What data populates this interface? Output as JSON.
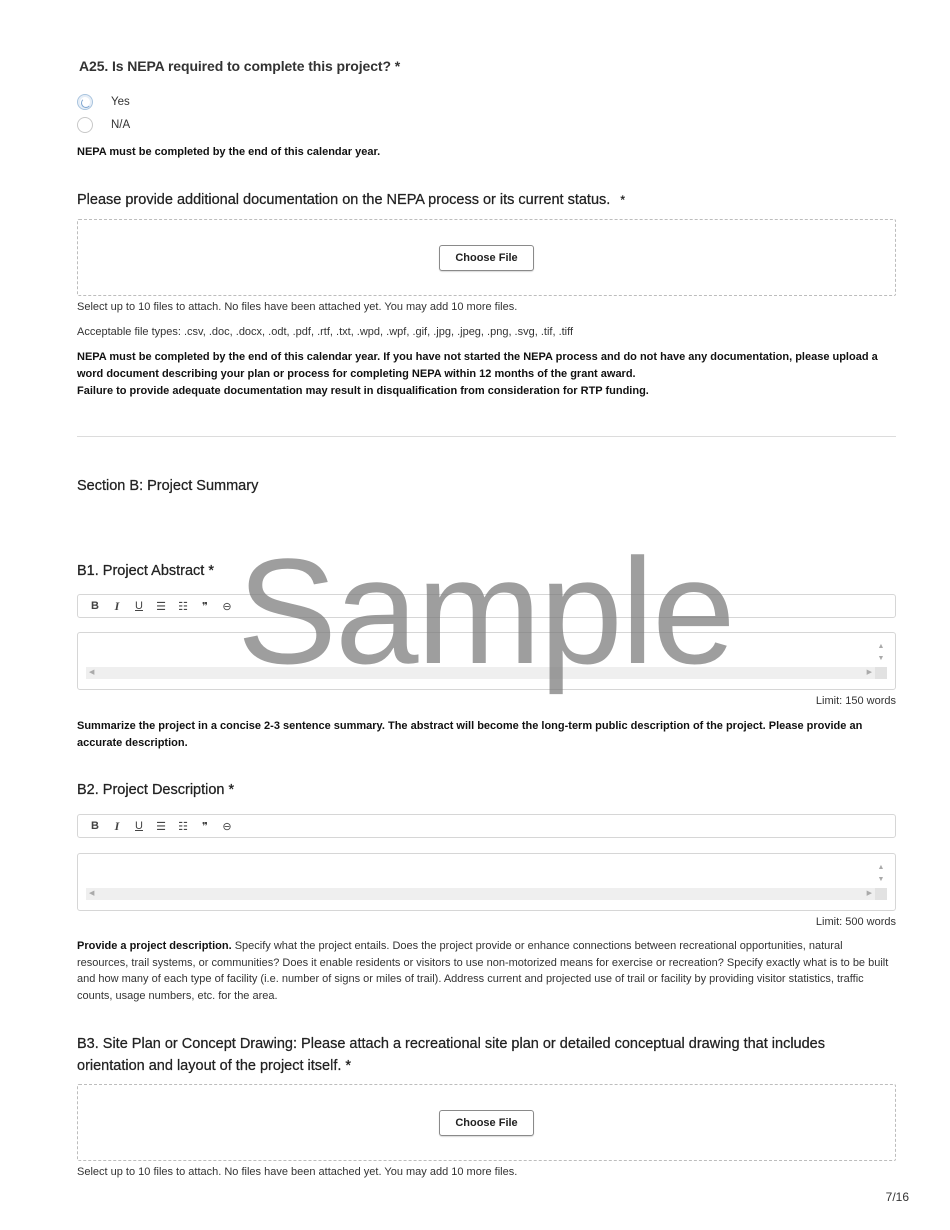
{
  "a25": {
    "title": "A25. Is NEPA required to complete this project? *",
    "options": [
      {
        "label": "Yes",
        "selected": false,
        "focused": true
      },
      {
        "label": "N/A",
        "selected": false,
        "focused": false
      }
    ],
    "note": "NEPA must be completed by the end of this calendar year."
  },
  "nepa_docs": {
    "title": "Please provide additional documentation on the NEPA process or its current status.",
    "required_mark": "*",
    "choose_file_label": "Choose File",
    "files_status": "Select up to 10 files to attach. No files have been attached yet. You may add 10 more files.",
    "file_types": "Acceptable file types: .csv, .doc, .docx, .odt, .pdf, .rtf, .txt, .wpd, .wpf, .gif, .jpg, .jpeg, .png, .svg, .tif, .tiff",
    "note_line1": "NEPA must be completed by the end of this calendar year. If you have not started the NEPA process and do not have any documentation, please upload a word document describing your plan or process for completing NEPA within 12 months of the grant award.",
    "note_line2": "Failure to provide adequate documentation may result in disqualification from consideration for RTP funding."
  },
  "section_b": {
    "title": "Section B: Project Summary"
  },
  "toolbar": {
    "bold": "B",
    "italic": "I",
    "underline": "U",
    "bullet_list": "☰",
    "numbered_list": "☷",
    "quote": "❞",
    "link": "⊖"
  },
  "b1": {
    "title": "B1. Project Abstract *",
    "value": "",
    "limit": "Limit: 150 words",
    "note": "Summarize the project in a concise 2-3 sentence summary. The abstract will become the long-term public description of the project. Please provide an accurate description."
  },
  "b2": {
    "title": "B2. Project Description *",
    "value": "",
    "limit": "Limit: 500 words",
    "note_bold": "Provide a project description.",
    "note_rest": " Specify what the project entails. Does the project provide or enhance connections between recreational opportunities, natural resources, trail systems, or communities? Does it enable residents or visitors to use non-motorized means for exercise or recreation? Specify exactly what is to be built and how many of each type of facility (i.e. number of signs or miles of trail). Address current and projected use of trail or facility by providing visitor statistics, traffic counts, usage numbers, etc. for the area."
  },
  "b3": {
    "title": "B3. Site Plan or Concept Drawing: Please attach a recreational site plan or detailed conceptual drawing that includes orientation and layout of the project itself. *",
    "choose_file_label": "Choose File",
    "files_status": "Select up to 10 files to attach. No files have been attached yet. You may add 10 more files."
  },
  "watermark": "Sample",
  "page_indicator": "7/16"
}
